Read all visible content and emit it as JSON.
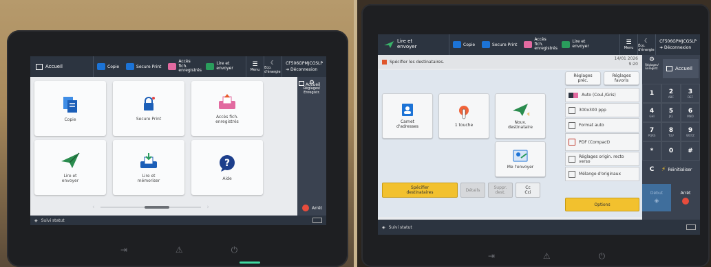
{
  "left_panel": {
    "topbar": {
      "home_label": "Accueil",
      "items": [
        {
          "label": "Copie",
          "icon": "copy-icon",
          "color": "#1c73d6"
        },
        {
          "label": "Secure Print",
          "icon": "secure-print-icon",
          "color": "#1c73d6"
        },
        {
          "label": "Accès fich. enregistrés",
          "icon": "stored-files-icon",
          "color": "#e26aa0"
        },
        {
          "label": "Lire et envoyer",
          "icon": "send-icon",
          "color": "#2a9d5c"
        }
      ],
      "menu_label": "Menu",
      "sleep_label": "Eco. d'énergie",
      "user_id": "CF506GPMJCGSLP",
      "logout_label": "Déconnexion",
      "settings_label": "Réglages/ Enregistr.",
      "home_side_label": "Accueil"
    },
    "tiles": [
      {
        "label": "Copie",
        "icon": "copy-icon"
      },
      {
        "label": "Secure Print",
        "icon": "lock-icon"
      },
      {
        "label": "Accès fich. enregistrés",
        "icon": "stored-files-icon"
      },
      {
        "label": "Lire et envoyer",
        "icon": "paper-plane-icon"
      },
      {
        "label": "Lire et mémoriser",
        "icon": "scan-store-icon"
      },
      {
        "label": "Aide",
        "icon": "help-icon"
      }
    ],
    "status_label": "Suivi statut",
    "stop_label": "Arrêt"
  },
  "right_panel": {
    "topbar": {
      "title": "Lire et envoyer",
      "items": [
        {
          "label": "Copie",
          "icon": "copy-icon",
          "color": "#1c73d6"
        },
        {
          "label": "Secure Print",
          "icon": "secure-print-icon",
          "color": "#1c73d6"
        },
        {
          "label": "Accès fich. enregistrés",
          "icon": "stored-files-icon",
          "color": "#e26aa0"
        },
        {
          "label": "Lire et envoyer",
          "icon": "send-icon",
          "color": "#2a9d5c"
        }
      ],
      "menu_label": "Menu",
      "sleep_label": "Éco. d'énergie",
      "user_id": "CF506GPMJCGSLP",
      "logout_label": "Déconnexion"
    },
    "message": "Spécifier les destinataires.",
    "date": "14/01 2026",
    "time": "9:20",
    "dest_tiles": [
      {
        "label": "Carnet d'adresses",
        "icon": "address-book-icon"
      },
      {
        "label": "1 touche",
        "icon": "one-touch-icon"
      },
      {
        "label": "Nouv. destinataire",
        "icon": "new-destination-icon"
      },
      {
        "label": "Me l'envoyer",
        "icon": "send-to-myself-icon"
      }
    ],
    "presets": {
      "prev": "Réglages préc.",
      "favs": "Réglages favoris"
    },
    "settings": [
      {
        "label": "Auto (Coul./Gris)",
        "icon": "color-mode-icon"
      },
      {
        "label": "300x300 ppp",
        "icon": "resolution-icon"
      },
      {
        "label": "Format auto",
        "icon": "size-icon"
      },
      {
        "label": "PDF (Compact)",
        "icon": "pdf-icon"
      },
      {
        "label": "Réglages origin. recto verso",
        "icon": "duplex-icon"
      },
      {
        "label": "Mélange d'originaux",
        "icon": "mixed-originals-icon"
      }
    ],
    "options_label": "Options",
    "specify_label": "Spécifier destinataires",
    "details_label": "Détails",
    "delete_label": "Suppr. dest.",
    "cc_label": "Cc Cci",
    "settings_side_label": "Réglages/ Enregistr.",
    "home_side_label": "Accueil",
    "keys": [
      {
        "k": "1",
        "s": ""
      },
      {
        "k": "2",
        "s": "ABC"
      },
      {
        "k": "3",
        "s": "DEF"
      },
      {
        "k": "4",
        "s": "GHI"
      },
      {
        "k": "5",
        "s": "JKL"
      },
      {
        "k": "6",
        "s": "MNO"
      },
      {
        "k": "7",
        "s": "PQRS"
      },
      {
        "k": "8",
        "s": "TUV"
      },
      {
        "k": "9",
        "s": "WXYZ"
      },
      {
        "k": "*",
        "s": ""
      },
      {
        "k": "0",
        "s": ""
      },
      {
        "k": "#",
        "s": ""
      }
    ],
    "clear_key": "C",
    "reset_label": "Réinitialiser",
    "start_label": "Début",
    "stop_label": "Arrêt",
    "status_label": "Suivi statut"
  }
}
